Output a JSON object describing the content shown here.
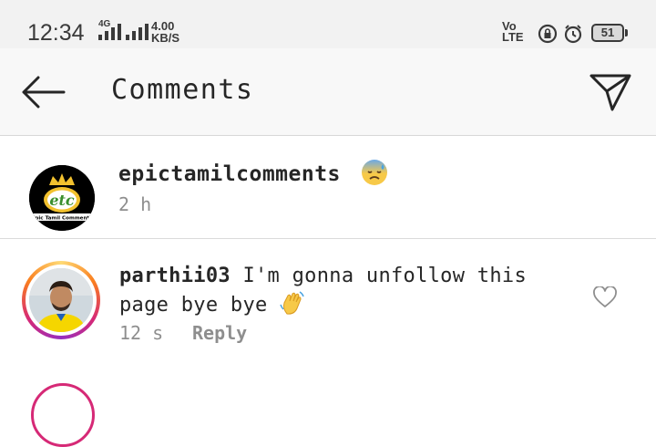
{
  "status_bar": {
    "time": "12:34",
    "network_type": "4G",
    "speed_value": "4.00",
    "speed_unit": "KB/S",
    "volte_top": "Vo",
    "volte_bottom": "LTE",
    "battery": "51"
  },
  "header": {
    "title": "Comments",
    "back_icon": "arrow-left-icon",
    "share_icon": "paper-plane-icon"
  },
  "caption": {
    "username": "epictamilcomments",
    "emoji": "downcast-face-with-sweat-emoji",
    "time": "2 h",
    "logo_text": "etc",
    "logo_subtext": "Epic Tamil Comments"
  },
  "comments": [
    {
      "username": "parthii03",
      "text": "I'm gonna unfollow this page bye bye",
      "emoji": "waving-hand-emoji",
      "time": "12 s",
      "reply_label": "Reply",
      "like_icon": "heart-outline-icon"
    }
  ],
  "colors": {
    "status_bar_bg": "#f2f2f2",
    "header_bg": "#f8f8f8",
    "text": "#262626",
    "muted": "#8e8e8e",
    "story_ring": "#d62976"
  }
}
